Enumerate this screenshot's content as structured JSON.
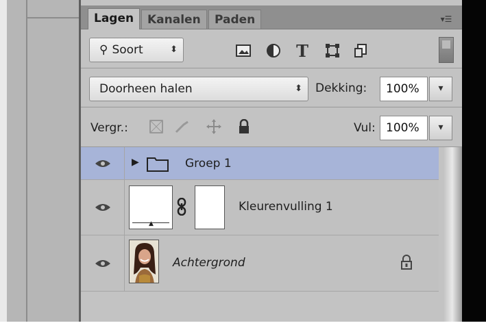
{
  "tabs": [
    {
      "label": "Lagen",
      "active": true
    },
    {
      "label": "Kanalen",
      "active": false
    },
    {
      "label": "Paden",
      "active": false
    }
  ],
  "panel_menu_icon": "panel-menu-icon",
  "filter": {
    "kind_label": "Soort",
    "icons": [
      "pixel-filter-icon",
      "adjustment-filter-icon",
      "type-filter-icon",
      "shape-filter-icon",
      "smart-object-filter-icon"
    ]
  },
  "blend": {
    "mode": "Doorheen halen",
    "opacity_label": "Dekking:",
    "opacity_value": "100%"
  },
  "lock": {
    "label": "Vergr.:",
    "fill_label": "Vul:",
    "fill_value": "100%"
  },
  "layers": [
    {
      "name": "Groep 1",
      "type": "group",
      "selected": true
    },
    {
      "name": "Kleurenvulling 1",
      "type": "fill"
    },
    {
      "name": "Achtergrond",
      "type": "background",
      "locked": true
    }
  ],
  "colors": {
    "panel_bg": "#c3c3c3",
    "selected_row": "#a7b4d8"
  }
}
